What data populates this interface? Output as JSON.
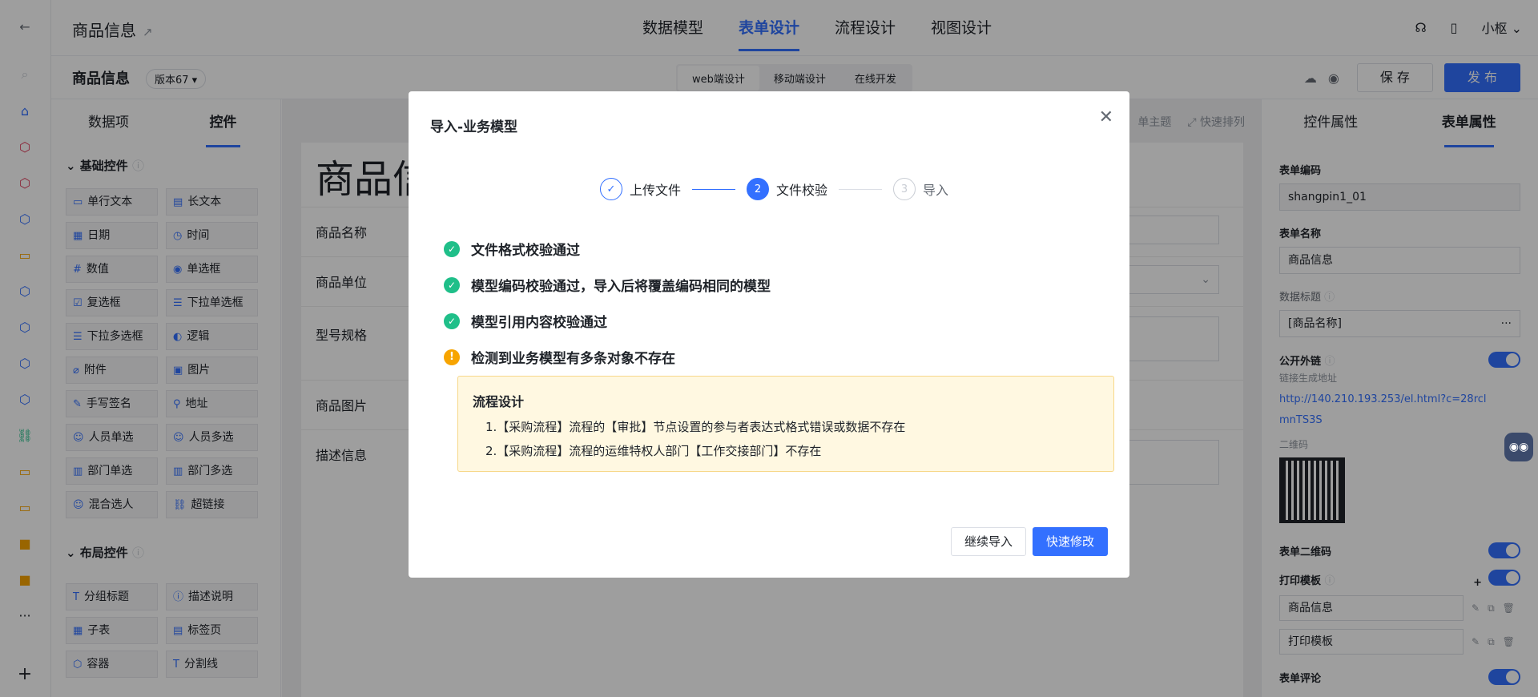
{
  "header": {
    "title": "商品信息",
    "tabs": [
      {
        "label": "数据模型"
      },
      {
        "label": "表单设计"
      },
      {
        "label": "流程设计"
      },
      {
        "label": "视图设计"
      }
    ],
    "user": "小枢"
  },
  "subbar": {
    "name": "商品信息",
    "version": "版本67",
    "modes": [
      {
        "label": "web端设计"
      },
      {
        "label": "移动端设计"
      },
      {
        "label": "在线开发"
      }
    ],
    "save_label": "保 存",
    "publish_label": "发 布"
  },
  "left_panel": {
    "tabs": [
      {
        "label": "数据项"
      },
      {
        "label": "控件"
      }
    ],
    "basic_section": "基础控件",
    "basic_controls": [
      {
        "label": "单行文本"
      },
      {
        "label": "长文本"
      },
      {
        "label": "日期"
      },
      {
        "label": "时间"
      },
      {
        "label": "数值"
      },
      {
        "label": "单选框"
      },
      {
        "label": "复选框"
      },
      {
        "label": "下拉单选框"
      },
      {
        "label": "下拉多选框"
      },
      {
        "label": "逻辑"
      },
      {
        "label": "附件"
      },
      {
        "label": "图片"
      },
      {
        "label": "手写签名"
      },
      {
        "label": "地址"
      },
      {
        "label": "人员单选"
      },
      {
        "label": "人员多选"
      },
      {
        "label": "部门单选"
      },
      {
        "label": "部门多选"
      },
      {
        "label": "混合选人"
      },
      {
        "label": "超链接"
      }
    ],
    "layout_section": "布局控件",
    "layout_controls": [
      {
        "label": "分组标题"
      },
      {
        "label": "描述说明"
      },
      {
        "label": "子表"
      },
      {
        "label": "标签页"
      },
      {
        "label": "容器"
      },
      {
        "label": "分割线"
      }
    ]
  },
  "canvas": {
    "form_title": "商品信",
    "tools": [
      "单主题",
      "快速排列"
    ],
    "rows": [
      {
        "label": "商品名称"
      },
      {
        "label": "商品单位"
      },
      {
        "label": "型号规格"
      },
      {
        "label": "商品图片"
      },
      {
        "label": "描述信息"
      }
    ]
  },
  "right_panel": {
    "tabs": [
      {
        "label": "控件属性"
      },
      {
        "label": "表单属性"
      }
    ],
    "form_code_label": "表单编码",
    "form_code": "shangpin1_01",
    "form_name_label": "表单名称",
    "form_name": "商品信息",
    "data_title_label": "数据标题",
    "data_title": "[商品名称]",
    "public_link_label": "公开外链",
    "link_hint": "链接生成地址",
    "link_url": "http://140.210.193.253/el.html?c=28rclmnTS3S",
    "qrcode_label": "二维码",
    "form_qrcode_label": "表单二维码",
    "print_template_label": "打印模板",
    "print_templates": [
      "商品信息",
      "打印模板"
    ],
    "form_comment_label": "表单评论"
  },
  "modal": {
    "title": "导入-业务模型",
    "steps": [
      {
        "num": "1",
        "label": "上传文件"
      },
      {
        "num": "2",
        "label": "文件校验"
      },
      {
        "num": "3",
        "label": "导入"
      }
    ],
    "checks": [
      {
        "text": "文件格式校验通过"
      },
      {
        "text": "模型编码校验通过，导入后将覆盖编码相同的模型"
      },
      {
        "text": "模型引用内容校验通过"
      }
    ],
    "warning": "检测到业务模型有多条对象不存在",
    "notice_title": "流程设计",
    "notice_items": [
      "1.【采购流程】流程的【审批】节点设置的参与者表达式格式错误或数据不存在",
      "2.【采购流程】流程的运维特权人部门【工作交接部门】不存在"
    ],
    "continue_label": "继续导入",
    "fix_label": "快速修改"
  },
  "colors": {
    "accent": "#3370ff",
    "success": "#1fbf89",
    "warning": "#f7a400"
  }
}
